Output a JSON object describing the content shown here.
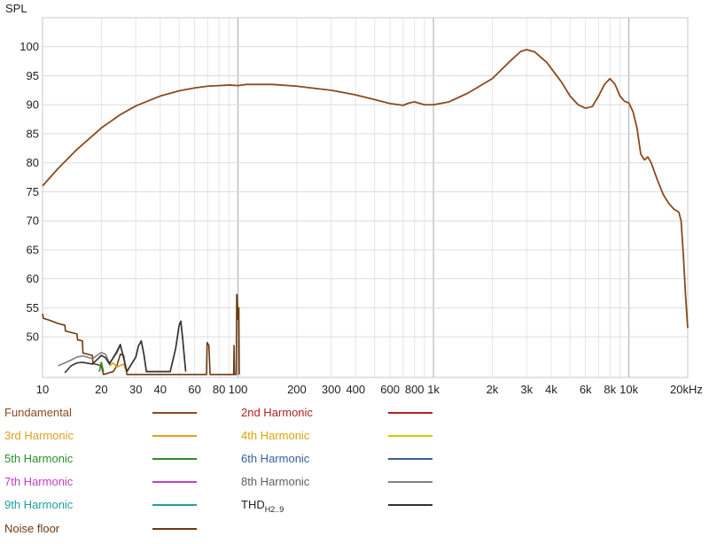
{
  "chart_data": {
    "type": "line",
    "ylabel": "SPL",
    "x_scale": "log",
    "xlim": [
      10,
      20000
    ],
    "ylim": [
      43,
      105
    ],
    "y_ticks": [
      50,
      55,
      60,
      65,
      70,
      75,
      80,
      85,
      90,
      95,
      100
    ],
    "x_ticks": [
      {
        "value": 10,
        "label": "10"
      },
      {
        "value": 20,
        "label": "20"
      },
      {
        "value": 30,
        "label": "30"
      },
      {
        "value": 40,
        "label": "40"
      },
      {
        "value": 60,
        "label": "60"
      },
      {
        "value": 80,
        "label": "80"
      },
      {
        "value": 100,
        "label": "100"
      },
      {
        "value": 200,
        "label": "200"
      },
      {
        "value": 300,
        "label": "300"
      },
      {
        "value": 400,
        "label": "400"
      },
      {
        "value": 600,
        "label": "600"
      },
      {
        "value": 800,
        "label": "800"
      },
      {
        "value": 1000,
        "label": "1k"
      },
      {
        "value": 2000,
        "label": "2k"
      },
      {
        "value": 3000,
        "label": "3k"
      },
      {
        "value": 4000,
        "label": "4k"
      },
      {
        "value": 6000,
        "label": "6k"
      },
      {
        "value": 8000,
        "label": "8k"
      },
      {
        "value": 10000,
        "label": "10k"
      },
      {
        "value": 20000,
        "label": "20kHz"
      }
    ],
    "grid": true,
    "series": [
      {
        "name": "Fundamental",
        "color": "#8b4a1e",
        "points": [
          [
            10,
            76
          ],
          [
            12,
            79
          ],
          [
            15,
            82.3
          ],
          [
            20,
            86
          ],
          [
            25,
            88.3
          ],
          [
            30,
            89.8
          ],
          [
            40,
            91.5
          ],
          [
            50,
            92.4
          ],
          [
            60,
            92.9
          ],
          [
            70,
            93.2
          ],
          [
            80,
            93.3
          ],
          [
            90,
            93.4
          ],
          [
            100,
            93.3
          ],
          [
            110,
            93.5
          ],
          [
            150,
            93.5
          ],
          [
            200,
            93.2
          ],
          [
            250,
            92.8
          ],
          [
            300,
            92.5
          ],
          [
            400,
            91.7
          ],
          [
            500,
            90.9
          ],
          [
            600,
            90.2
          ],
          [
            700,
            89.9
          ],
          [
            750,
            90.3
          ],
          [
            800,
            90.5
          ],
          [
            900,
            90
          ],
          [
            1000,
            90
          ],
          [
            1200,
            90.5
          ],
          [
            1500,
            92
          ],
          [
            2000,
            94.5
          ],
          [
            2500,
            97.7
          ],
          [
            2800,
            99.2
          ],
          [
            3000,
            99.5
          ],
          [
            3300,
            99.1
          ],
          [
            3800,
            97.3
          ],
          [
            4500,
            94
          ],
          [
            5000,
            91.5
          ],
          [
            5500,
            90
          ],
          [
            6000,
            89.4
          ],
          [
            6500,
            89.7
          ],
          [
            7000,
            91.5
          ],
          [
            7500,
            93.5
          ],
          [
            8000,
            94.5
          ],
          [
            8500,
            93.5
          ],
          [
            9000,
            91.5
          ],
          [
            9500,
            90.6
          ],
          [
            10000,
            90.3
          ],
          [
            10500,
            88.8
          ],
          [
            11000,
            86
          ],
          [
            11500,
            81.5
          ],
          [
            12000,
            80.5
          ],
          [
            12500,
            81
          ],
          [
            13000,
            80
          ],
          [
            14000,
            77
          ],
          [
            15000,
            74.5
          ],
          [
            16000,
            73
          ],
          [
            17000,
            72
          ],
          [
            18000,
            71.5
          ],
          [
            18500,
            70
          ],
          [
            19000,
            64
          ],
          [
            19500,
            57
          ],
          [
            20000,
            51.5
          ]
        ]
      },
      {
        "name": "2nd Harmonic",
        "color": "#b22222",
        "points": []
      },
      {
        "name": "3rd Harmonic",
        "color": "#e0a020",
        "points": [
          [
            22,
            45
          ],
          [
            23,
            45.5
          ],
          [
            24,
            44.8
          ],
          [
            26,
            45.3
          ],
          [
            27,
            43.8
          ]
        ]
      },
      {
        "name": "4th Harmonic",
        "color": "#d8c800",
        "points": []
      },
      {
        "name": "5th Harmonic",
        "color": "#2e8b2e",
        "points": [
          [
            19.5,
            44
          ],
          [
            20,
            45.6
          ],
          [
            20.5,
            44
          ]
        ]
      },
      {
        "name": "6th Harmonic",
        "color": "#3a5f9a",
        "points": []
      },
      {
        "name": "7th Harmonic",
        "color": "#c040c0",
        "points": []
      },
      {
        "name": "8th Harmonic",
        "color": "#808080",
        "points": [
          [
            12,
            45
          ],
          [
            13,
            45.5
          ],
          [
            14,
            46
          ],
          [
            15,
            46.5
          ],
          [
            16,
            46.7
          ],
          [
            17,
            46.5
          ],
          [
            18,
            46.2
          ],
          [
            19,
            46.8
          ],
          [
            20,
            47.3
          ],
          [
            21,
            47
          ],
          [
            22,
            45.5
          ],
          [
            24,
            47.2
          ],
          [
            25,
            48.5
          ],
          [
            26,
            46.5
          ],
          [
            27,
            44
          ],
          [
            30,
            46.5
          ],
          [
            31,
            48.5
          ],
          [
            32,
            49.2
          ],
          [
            33,
            47
          ],
          [
            34,
            44
          ],
          [
            45,
            44
          ],
          [
            48,
            48
          ],
          [
            50,
            52
          ],
          [
            51,
            52.5
          ],
          [
            52,
            50
          ],
          [
            54,
            44
          ]
        ]
      },
      {
        "name": "THDH2..9",
        "color": "#333333",
        "points": [
          [
            13,
            43.8
          ],
          [
            14,
            45
          ],
          [
            15,
            45.5
          ],
          [
            16,
            45.6
          ],
          [
            18,
            45.3
          ],
          [
            20,
            46.8
          ],
          [
            21,
            46.4
          ],
          [
            22,
            45.3
          ],
          [
            24,
            47.5
          ],
          [
            25,
            48.7
          ],
          [
            26,
            46.3
          ],
          [
            27,
            44
          ],
          [
            30,
            46.5
          ],
          [
            31,
            48.5
          ],
          [
            32,
            49.3
          ],
          [
            33,
            47
          ],
          [
            34,
            44
          ],
          [
            45,
            44
          ],
          [
            48,
            48
          ],
          [
            50,
            52
          ],
          [
            51,
            52.7
          ],
          [
            52,
            50
          ],
          [
            54,
            44
          ]
        ]
      },
      {
        "name": "Noise floor",
        "color": "#6b3a12",
        "points": [
          [
            10,
            54
          ],
          [
            10.1,
            53.2
          ],
          [
            11,
            52.8
          ],
          [
            12,
            52.3
          ],
          [
            13,
            52
          ],
          [
            13.1,
            51
          ],
          [
            15,
            50.5
          ],
          [
            15.1,
            49.5
          ],
          [
            16,
            49.3
          ],
          [
            16.1,
            47.2
          ],
          [
            18,
            46.8
          ],
          [
            18.1,
            45.4
          ],
          [
            20,
            45
          ],
          [
            20.5,
            43.5
          ],
          [
            23,
            44
          ],
          [
            24,
            45
          ],
          [
            25,
            47
          ],
          [
            26,
            46.8
          ],
          [
            27,
            43.5
          ],
          [
            69,
            43.5
          ],
          [
            69.5,
            49
          ],
          [
            71,
            48.5
          ],
          [
            72,
            43.5
          ],
          [
            95,
            43.5
          ],
          [
            95.5,
            48.5
          ],
          [
            96,
            43.5
          ],
          [
            98,
            43.5
          ],
          [
            98.5,
            57.3
          ],
          [
            99,
            57
          ],
          [
            100,
            53
          ],
          [
            101,
            55
          ],
          [
            101.5,
            43.5
          ]
        ]
      }
    ],
    "legend": [
      {
        "label": "Fundamental",
        "color": "#8b4a1e",
        "text_color": "#8b4a1e"
      },
      {
        "label": "2nd Harmonic",
        "color": "#b22222",
        "text_color": "#b22222"
      },
      {
        "label": "3rd Harmonic",
        "color": "#e0a020",
        "text_color": "#e0a020"
      },
      {
        "label": "4th Harmonic",
        "color": "#d8c800",
        "text_color": "#d8a800"
      },
      {
        "label": "5th Harmonic",
        "color": "#2e8b2e",
        "text_color": "#2e8b2e"
      },
      {
        "label": "6th Harmonic",
        "color": "#3a5f9a",
        "text_color": "#3a5f9a"
      },
      {
        "label": "7th Harmonic",
        "color": "#c040c0",
        "text_color": "#c040c0"
      },
      {
        "label": "8th Harmonic",
        "color": "#808080",
        "text_color": "#606060"
      },
      {
        "label": "9th Harmonic",
        "color": "#20a0a0",
        "text_color": "#20a0a0"
      },
      {
        "label": "THD",
        "sub": "H2..9",
        "color": "#333333",
        "text_color": "#222222"
      },
      {
        "label": "Noise floor",
        "color": "#6b3a12",
        "text_color": "#6b3a12"
      }
    ],
    "legend_placement": "bottom"
  }
}
